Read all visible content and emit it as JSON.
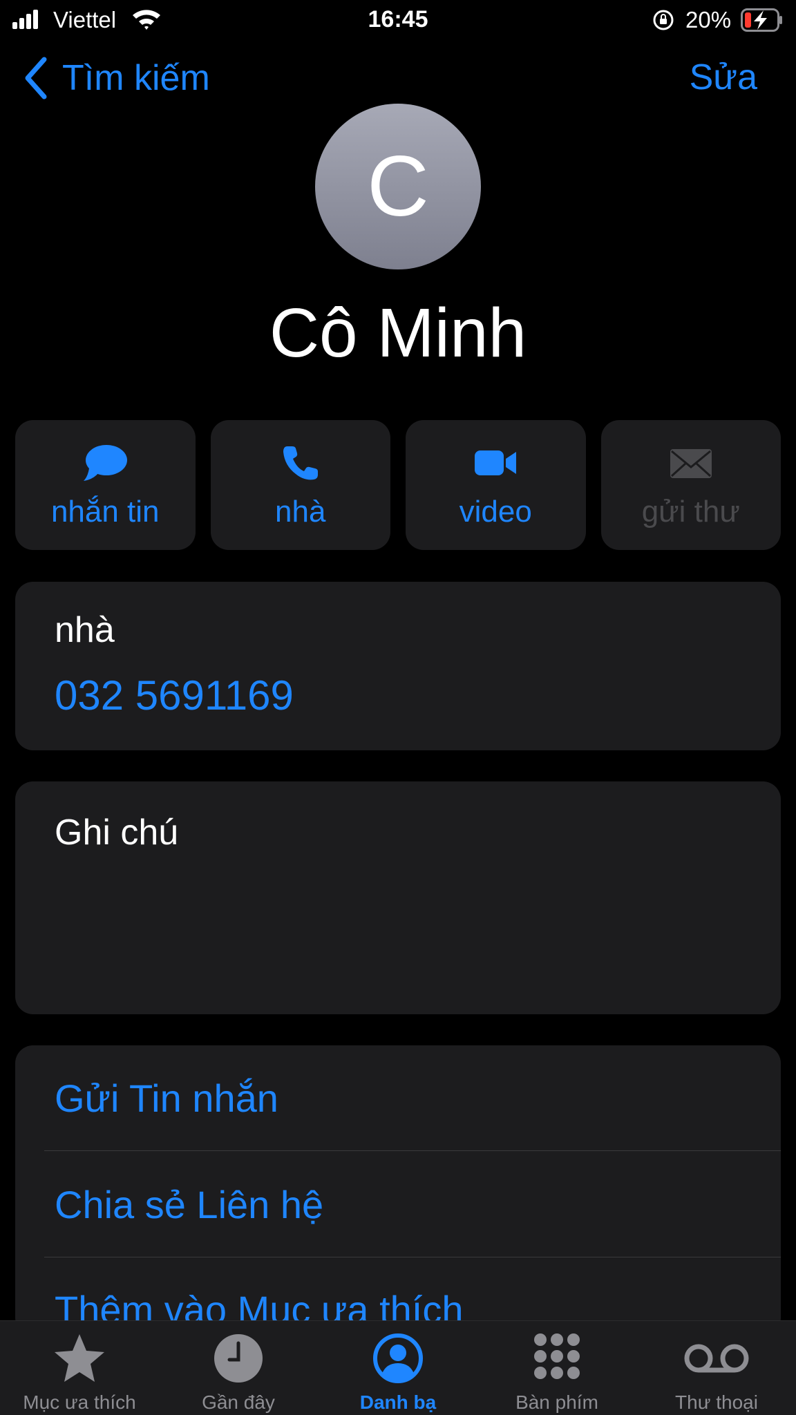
{
  "status_bar": {
    "carrier": "Viettel",
    "time": "16:45",
    "battery_percent": "20%"
  },
  "nav": {
    "back_label": "Tìm kiếm",
    "edit_label": "Sửa"
  },
  "contact": {
    "avatar_initial": "C",
    "name": "Cô Minh"
  },
  "actions": [
    {
      "label": "nhắn tin",
      "icon": "message-icon",
      "enabled": true
    },
    {
      "label": "nhà",
      "icon": "phone-icon",
      "enabled": true
    },
    {
      "label": "video",
      "icon": "video-icon",
      "enabled": true
    },
    {
      "label": "gửi thư",
      "icon": "mail-icon",
      "enabled": false
    }
  ],
  "phone": {
    "label": "nhà",
    "number": "032 5691169"
  },
  "notes": {
    "label": "Ghi chú"
  },
  "links": [
    {
      "label": "Gửi Tin nhắn"
    },
    {
      "label": "Chia sẻ Liên hệ"
    },
    {
      "label": "Thêm vào Mục ưa thích"
    }
  ],
  "tabs": [
    {
      "label": "Mục ưa thích",
      "icon": "star-icon",
      "active": false
    },
    {
      "label": "Gần đây",
      "icon": "clock-icon",
      "active": false
    },
    {
      "label": "Danh bạ",
      "icon": "contacts-icon",
      "active": true
    },
    {
      "label": "Bàn phím",
      "icon": "keypad-icon",
      "active": false
    },
    {
      "label": "Thư thoại",
      "icon": "voicemail-icon",
      "active": false
    }
  ],
  "colors": {
    "accent": "#1f86ff",
    "background": "#000000",
    "card": "#1c1c1e",
    "inactive": "#8e8e93"
  }
}
